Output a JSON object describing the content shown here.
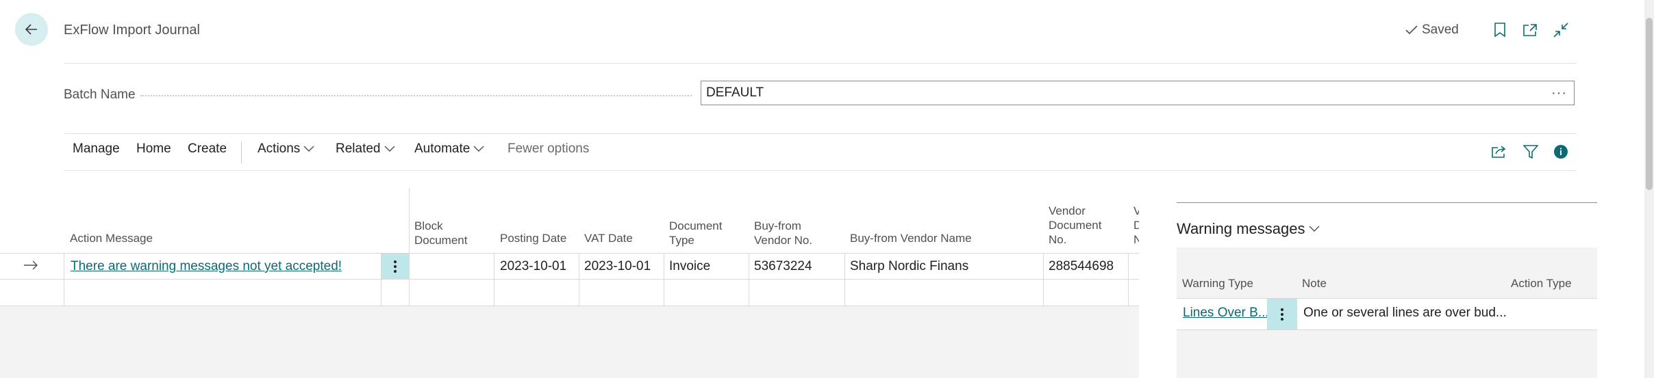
{
  "header": {
    "title": "ExFlow Import Journal",
    "saved_label": "Saved",
    "back_icon": "arrow-left-icon",
    "bookmark_icon": "bookmark-icon",
    "open_new_icon": "open-in-new-window-icon",
    "collapse_icon": "collapse-icon"
  },
  "batch": {
    "label": "Batch Name",
    "value": "DEFAULT",
    "more": "···"
  },
  "actionbar": {
    "items": [
      "Manage",
      "Home",
      "Create",
      "Actions",
      "Related",
      "Automate",
      "Fewer options"
    ]
  },
  "grid": {
    "columns": {
      "action_message": "Action Message",
      "block_document": [
        "Block",
        "Document"
      ],
      "posting_date": "Posting Date",
      "vat_date": "VAT Date",
      "document_type": [
        "Document",
        "Type"
      ],
      "buy_from_vendor_no": [
        "Buy-from",
        "Vendor No."
      ],
      "buy_from_vendor_name": "Buy-from Vendor Name",
      "vendor_document_no": [
        "Vendor",
        "Document",
        "No."
      ],
      "truncated": [
        "V",
        "D",
        "N"
      ]
    },
    "rows": [
      {
        "action_message": "There are warning messages not yet accepted!",
        "block_document": "",
        "posting_date": "2023-10-01",
        "vat_date": "2023-10-01",
        "document_type": "Invoice",
        "buy_from_vendor_no": "53673224",
        "buy_from_vendor_name": "Sharp Nordic Finans",
        "vendor_document_no": "288544698"
      }
    ]
  },
  "warnings": {
    "title": "Warning messages",
    "columns": [
      "Warning Type",
      "Note",
      "Action Type"
    ],
    "rows": [
      {
        "warning_type": "Lines Over B...",
        "note": "One or several lines are over bud...",
        "action_type": ""
      }
    ]
  },
  "colors": {
    "accent": "#0b6a73",
    "selection": "#bfe6e9",
    "back_button_bg": "#d7eef0"
  }
}
